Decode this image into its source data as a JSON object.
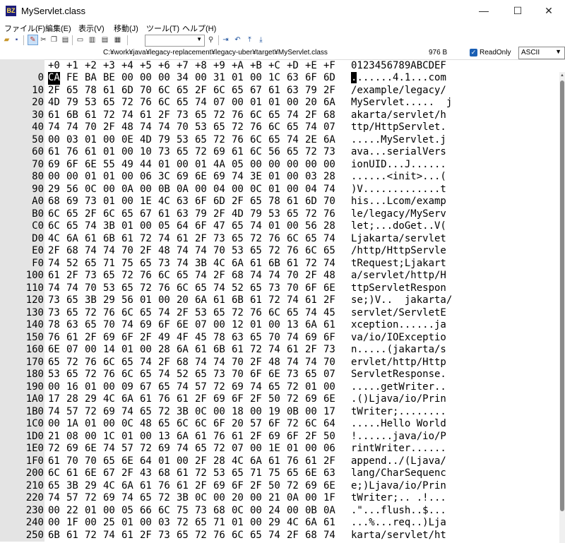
{
  "window": {
    "title": "MyServlet.class",
    "icon_label": "BZ"
  },
  "menu": [
    "ファイル(F)",
    "編集(E)",
    "表示(V)",
    "移動(J)",
    "ツール(T)",
    "ヘルプ(H)"
  ],
  "toolbar": {
    "icons": [
      "open-folder-icon",
      "save-icon",
      "edit-mode-icon",
      "cut-icon",
      "copy-icon",
      "paste-icon",
      "single-view-icon",
      "split-view-icon",
      "horizontal-split-icon",
      "compare-view-icon",
      "search-icon",
      "jump-icon",
      "undo-icon",
      "mark-top-icon",
      "mark-bottom-icon"
    ],
    "search_value": ""
  },
  "pathbar": {
    "path": "C:¥work¥java¥legacy-replacement¥legacy-uber¥target¥MyServlet.class",
    "size": "976 B",
    "readonly_label": "ReadOnly",
    "readonly_checked": true,
    "encoding": "ASCII"
  },
  "header": {
    "columns": [
      "+0",
      "+1",
      "+2",
      "+3",
      "+4",
      "+5",
      "+6",
      "+7",
      "+8",
      "+9",
      "+A",
      "+B",
      "+C",
      "+D",
      "+E",
      "+F"
    ],
    "ascii": "0123456789ABCDEF"
  },
  "rows": [
    {
      "addr": "0",
      "hex": [
        "CA",
        "FE",
        "BA",
        "BE",
        "00",
        "00",
        "00",
        "34",
        "00",
        "31",
        "01",
        "00",
        "1C",
        "63",
        "6F",
        "6D"
      ],
      "ascii": ".......4.1...com"
    },
    {
      "addr": "10",
      "hex": [
        "2F",
        "65",
        "78",
        "61",
        "6D",
        "70",
        "6C",
        "65",
        "2F",
        "6C",
        "65",
        "67",
        "61",
        "63",
        "79",
        "2F"
      ],
      "ascii": "/example/legacy/"
    },
    {
      "addr": "20",
      "hex": [
        "4D",
        "79",
        "53",
        "65",
        "72",
        "76",
        "6C",
        "65",
        "74",
        "07",
        "00",
        "01",
        "01",
        "00",
        "20",
        "6A"
      ],
      "ascii": "MyServlet.....  j"
    },
    {
      "addr": "30",
      "hex": [
        "61",
        "6B",
        "61",
        "72",
        "74",
        "61",
        "2F",
        "73",
        "65",
        "72",
        "76",
        "6C",
        "65",
        "74",
        "2F",
        "68"
      ],
      "ascii": "akarta/servlet/h"
    },
    {
      "addr": "40",
      "hex": [
        "74",
        "74",
        "70",
        "2F",
        "48",
        "74",
        "74",
        "70",
        "53",
        "65",
        "72",
        "76",
        "6C",
        "65",
        "74",
        "07"
      ],
      "ascii": "ttp/HttpServlet."
    },
    {
      "addr": "50",
      "hex": [
        "00",
        "03",
        "01",
        "00",
        "0E",
        "4D",
        "79",
        "53",
        "65",
        "72",
        "76",
        "6C",
        "65",
        "74",
        "2E",
        "6A"
      ],
      "ascii": ".....MyServlet.j"
    },
    {
      "addr": "60",
      "hex": [
        "61",
        "76",
        "61",
        "01",
        "00",
        "10",
        "73",
        "65",
        "72",
        "69",
        "61",
        "6C",
        "56",
        "65",
        "72",
        "73"
      ],
      "ascii": "ava...serialVers"
    },
    {
      "addr": "70",
      "hex": [
        "69",
        "6F",
        "6E",
        "55",
        "49",
        "44",
        "01",
        "00",
        "01",
        "4A",
        "05",
        "00",
        "00",
        "00",
        "00",
        "00"
      ],
      "ascii": "ionUID...J......"
    },
    {
      "addr": "80",
      "hex": [
        "00",
        "00",
        "01",
        "01",
        "00",
        "06",
        "3C",
        "69",
        "6E",
        "69",
        "74",
        "3E",
        "01",
        "00",
        "03",
        "28"
      ],
      "ascii": "......<init>...("
    },
    {
      "addr": "90",
      "hex": [
        "29",
        "56",
        "0C",
        "00",
        "0A",
        "00",
        "0B",
        "0A",
        "00",
        "04",
        "00",
        "0C",
        "01",
        "00",
        "04",
        "74"
      ],
      "ascii": ")V.............t"
    },
    {
      "addr": "A0",
      "hex": [
        "68",
        "69",
        "73",
        "01",
        "00",
        "1E",
        "4C",
        "63",
        "6F",
        "6D",
        "2F",
        "65",
        "78",
        "61",
        "6D",
        "70"
      ],
      "ascii": "his...Lcom/examp"
    },
    {
      "addr": "B0",
      "hex": [
        "6C",
        "65",
        "2F",
        "6C",
        "65",
        "67",
        "61",
        "63",
        "79",
        "2F",
        "4D",
        "79",
        "53",
        "65",
        "72",
        "76"
      ],
      "ascii": "le/legacy/MyServ"
    },
    {
      "addr": "C0",
      "hex": [
        "6C",
        "65",
        "74",
        "3B",
        "01",
        "00",
        "05",
        "64",
        "6F",
        "47",
        "65",
        "74",
        "01",
        "00",
        "56",
        "28"
      ],
      "ascii": "let;...doGet..V("
    },
    {
      "addr": "D0",
      "hex": [
        "4C",
        "6A",
        "61",
        "6B",
        "61",
        "72",
        "74",
        "61",
        "2F",
        "73",
        "65",
        "72",
        "76",
        "6C",
        "65",
        "74"
      ],
      "ascii": "Ljakarta/servlet"
    },
    {
      "addr": "E0",
      "hex": [
        "2F",
        "68",
        "74",
        "74",
        "70",
        "2F",
        "48",
        "74",
        "74",
        "70",
        "53",
        "65",
        "72",
        "76",
        "6C",
        "65"
      ],
      "ascii": "/http/HttpServle"
    },
    {
      "addr": "F0",
      "hex": [
        "74",
        "52",
        "65",
        "71",
        "75",
        "65",
        "73",
        "74",
        "3B",
        "4C",
        "6A",
        "61",
        "6B",
        "61",
        "72",
        "74"
      ],
      "ascii": "tRequest;Ljakart"
    },
    {
      "addr": "100",
      "hex": [
        "61",
        "2F",
        "73",
        "65",
        "72",
        "76",
        "6C",
        "65",
        "74",
        "2F",
        "68",
        "74",
        "74",
        "70",
        "2F",
        "48"
      ],
      "ascii": "a/servlet/http/H"
    },
    {
      "addr": "110",
      "hex": [
        "74",
        "74",
        "70",
        "53",
        "65",
        "72",
        "76",
        "6C",
        "65",
        "74",
        "52",
        "65",
        "73",
        "70",
        "6F",
        "6E"
      ],
      "ascii": "ttpServletRespon"
    },
    {
      "addr": "120",
      "hex": [
        "73",
        "65",
        "3B",
        "29",
        "56",
        "01",
        "00",
        "20",
        "6A",
        "61",
        "6B",
        "61",
        "72",
        "74",
        "61",
        "2F"
      ],
      "ascii": "se;)V..  jakarta/"
    },
    {
      "addr": "130",
      "hex": [
        "73",
        "65",
        "72",
        "76",
        "6C",
        "65",
        "74",
        "2F",
        "53",
        "65",
        "72",
        "76",
        "6C",
        "65",
        "74",
        "45"
      ],
      "ascii": "servlet/ServletE"
    },
    {
      "addr": "140",
      "hex": [
        "78",
        "63",
        "65",
        "70",
        "74",
        "69",
        "6F",
        "6E",
        "07",
        "00",
        "12",
        "01",
        "00",
        "13",
        "6A",
        "61"
      ],
      "ascii": "xception......ja"
    },
    {
      "addr": "150",
      "hex": [
        "76",
        "61",
        "2F",
        "69",
        "6F",
        "2F",
        "49",
        "4F",
        "45",
        "78",
        "63",
        "65",
        "70",
        "74",
        "69",
        "6F"
      ],
      "ascii": "va/io/IOExceptio"
    },
    {
      "addr": "160",
      "hex": [
        "6E",
        "07",
        "00",
        "14",
        "01",
        "00",
        "28",
        "6A",
        "61",
        "6B",
        "61",
        "72",
        "74",
        "61",
        "2F",
        "73"
      ],
      "ascii": "n.....(jakarta/s"
    },
    {
      "addr": "170",
      "hex": [
        "65",
        "72",
        "76",
        "6C",
        "65",
        "74",
        "2F",
        "68",
        "74",
        "74",
        "70",
        "2F",
        "48",
        "74",
        "74",
        "70"
      ],
      "ascii": "ervlet/http/Http"
    },
    {
      "addr": "180",
      "hex": [
        "53",
        "65",
        "72",
        "76",
        "6C",
        "65",
        "74",
        "52",
        "65",
        "73",
        "70",
        "6F",
        "6E",
        "73",
        "65",
        "07"
      ],
      "ascii": "ServletResponse."
    },
    {
      "addr": "190",
      "hex": [
        "00",
        "16",
        "01",
        "00",
        "09",
        "67",
        "65",
        "74",
        "57",
        "72",
        "69",
        "74",
        "65",
        "72",
        "01",
        "00"
      ],
      "ascii": ".....getWriter.."
    },
    {
      "addr": "1A0",
      "hex": [
        "17",
        "28",
        "29",
        "4C",
        "6A",
        "61",
        "76",
        "61",
        "2F",
        "69",
        "6F",
        "2F",
        "50",
        "72",
        "69",
        "6E"
      ],
      "ascii": ".()Ljava/io/Prin"
    },
    {
      "addr": "1B0",
      "hex": [
        "74",
        "57",
        "72",
        "69",
        "74",
        "65",
        "72",
        "3B",
        "0C",
        "00",
        "18",
        "00",
        "19",
        "0B",
        "00",
        "17"
      ],
      "ascii": "tWriter;........"
    },
    {
      "addr": "1C0",
      "hex": [
        "00",
        "1A",
        "01",
        "00",
        "0C",
        "48",
        "65",
        "6C",
        "6C",
        "6F",
        "20",
        "57",
        "6F",
        "72",
        "6C",
        "64"
      ],
      "ascii": ".....Hello World"
    },
    {
      "addr": "1D0",
      "hex": [
        "21",
        "08",
        "00",
        "1C",
        "01",
        "00",
        "13",
        "6A",
        "61",
        "76",
        "61",
        "2F",
        "69",
        "6F",
        "2F",
        "50"
      ],
      "ascii": "!......java/io/P"
    },
    {
      "addr": "1E0",
      "hex": [
        "72",
        "69",
        "6E",
        "74",
        "57",
        "72",
        "69",
        "74",
        "65",
        "72",
        "07",
        "00",
        "1E",
        "01",
        "00",
        "06"
      ],
      "ascii": "rintWriter......"
    },
    {
      "addr": "1F0",
      "hex": [
        "61",
        "70",
        "70",
        "65",
        "6E",
        "64",
        "01",
        "00",
        "2F",
        "28",
        "4C",
        "6A",
        "61",
        "76",
        "61",
        "2F"
      ],
      "ascii": "append../(Ljava/"
    },
    {
      "addr": "200",
      "hex": [
        "6C",
        "61",
        "6E",
        "67",
        "2F",
        "43",
        "68",
        "61",
        "72",
        "53",
        "65",
        "71",
        "75",
        "65",
        "6E",
        "63"
      ],
      "ascii": "lang/CharSequenc"
    },
    {
      "addr": "210",
      "hex": [
        "65",
        "3B",
        "29",
        "4C",
        "6A",
        "61",
        "76",
        "61",
        "2F",
        "69",
        "6F",
        "2F",
        "50",
        "72",
        "69",
        "6E"
      ],
      "ascii": "e;)Ljava/io/Prin"
    },
    {
      "addr": "220",
      "hex": [
        "74",
        "57",
        "72",
        "69",
        "74",
        "65",
        "72",
        "3B",
        "0C",
        "00",
        "20",
        "00",
        "21",
        "0A",
        "00",
        "1F"
      ],
      "ascii": "tWriter;.. .!..."
    },
    {
      "addr": "230",
      "hex": [
        "00",
        "22",
        "01",
        "00",
        "05",
        "66",
        "6C",
        "75",
        "73",
        "68",
        "0C",
        "00",
        "24",
        "00",
        "0B",
        "0A"
      ],
      "ascii": ".\"...flush..$..."
    },
    {
      "addr": "240",
      "hex": [
        "00",
        "1F",
        "00",
        "25",
        "01",
        "00",
        "03",
        "72",
        "65",
        "71",
        "01",
        "00",
        "29",
        "4C",
        "6A",
        "61"
      ],
      "ascii": "...%...req..)Lja"
    },
    {
      "addr": "250",
      "hex": [
        "6B",
        "61",
        "72",
        "74",
        "61",
        "2F",
        "73",
        "65",
        "72",
        "76",
        "6C",
        "65",
        "74",
        "2F",
        "68",
        "74"
      ],
      "ascii": "karta/servlet/ht"
    }
  ]
}
